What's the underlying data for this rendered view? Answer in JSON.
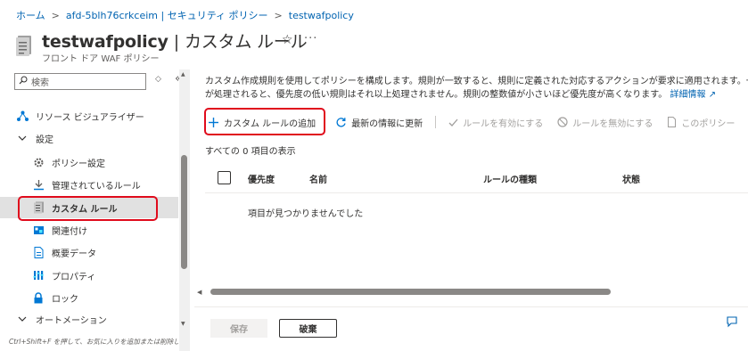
{
  "breadcrumb": {
    "items": [
      "ホーム",
      "afd-5blh76crkceim | セキュリティ ポリシー",
      "testwafpolicy"
    ],
    "separator": ">"
  },
  "header": {
    "title": "testwafpolicy",
    "title_sep": "|",
    "title_section": "カスタム ルール",
    "subtitle": "フロント ドア WAF ポリシー",
    "favorite_icon": "star-icon",
    "more_icon": "ellipsis-icon"
  },
  "sidebar": {
    "search_placeholder": "検索",
    "items": [
      {
        "label": "リソース ビジュアライザー",
        "icon": "resource-visualizer-icon"
      },
      {
        "label": "設定",
        "icon": "chevron-down-icon"
      },
      {
        "label": "ポリシー設定",
        "icon": "gear-icon"
      },
      {
        "label": "管理されているルール",
        "icon": "managed-rules-icon"
      },
      {
        "label": "カスタム ルール",
        "icon": "custom-rules-icon",
        "selected": true
      },
      {
        "label": "関連付け",
        "icon": "association-icon"
      },
      {
        "label": "概要データ",
        "icon": "document-icon"
      },
      {
        "label": "プロパティ",
        "icon": "properties-icon"
      },
      {
        "label": "ロック",
        "icon": "lock-icon"
      },
      {
        "label": "オートメーション",
        "icon": "chevron-down-icon"
      }
    ],
    "hint": "Ctrl+Shift+F を押して、お気に入りを追加または削除しま す"
  },
  "main": {
    "description_line1": "カスタム作成規則を使用してポリシーを構成します。規則が一致すると、規則に定義された対応するアクションが要求に適用されます。一致した規則",
    "description_line2": "が処理されると、優先度の低い規則はそれ以上処理されません。規則の整数値が小さいほど優先度が高くなります。",
    "learn_more": "詳細情報",
    "toolbar": {
      "add": "カスタム ルールの追加",
      "refresh": "最新の情報に更新",
      "enable": "ルールを有効にする",
      "disable": "ルールを無効にする",
      "policy": "このポリシー"
    },
    "count": "すべての 0 項目の表示",
    "columns": [
      "優先度",
      "名前",
      "ルールの種類",
      "状態"
    ],
    "empty": "項目が見つかりませんでした"
  },
  "footer": {
    "save": "保存",
    "discard": "破棄"
  },
  "colors": {
    "accent": "#0063b1",
    "highlight": "#e00b1c",
    "selected_bg": "#e1e1e1"
  }
}
